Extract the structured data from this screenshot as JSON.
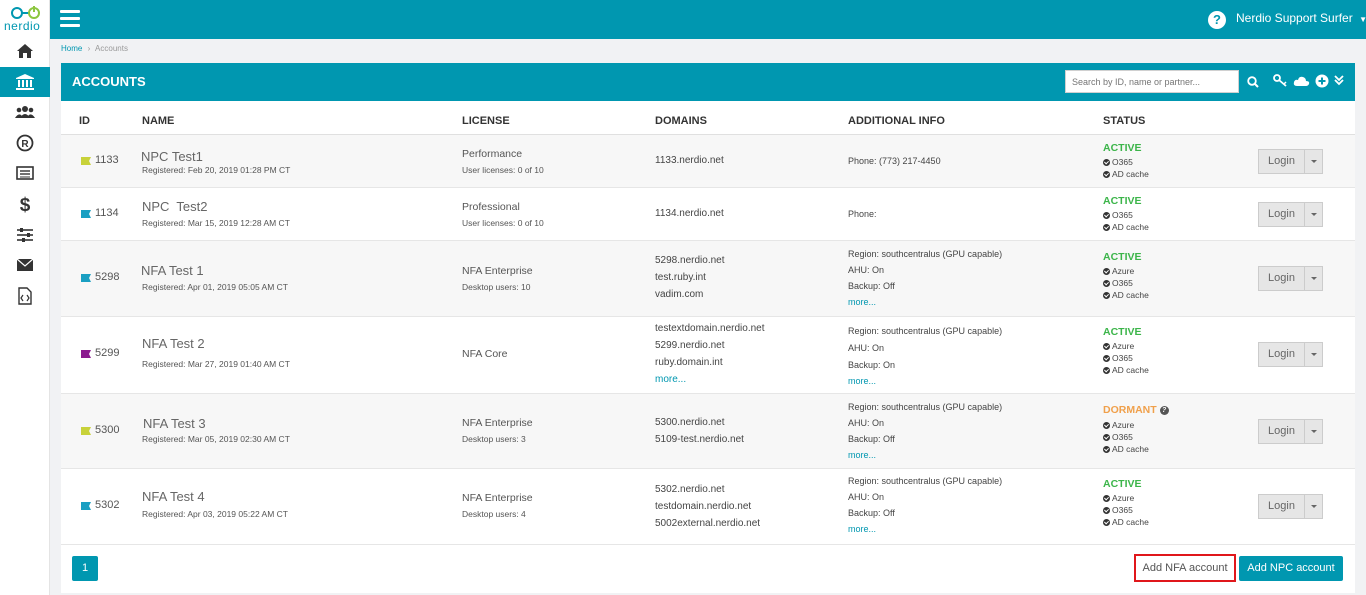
{
  "app": {
    "logo_text": "nerdio"
  },
  "topbar": {
    "user_name": "Nerdio Support Surfer"
  },
  "breadcrumb": {
    "home": "Home",
    "separator": "›",
    "current": "Accounts"
  },
  "panel": {
    "title": "ACCOUNTS",
    "search_placeholder": "Search by ID, name or partner..."
  },
  "columns": {
    "id": "ID",
    "name": "NAME",
    "license": "LICENSE",
    "domains": "DOMAINS",
    "info": "ADDITIONAL INFO",
    "status": "STATUS"
  },
  "colors": {
    "accent": "#0097b0",
    "active": "#3cb54a",
    "dormant": "#f0a04b",
    "highlight": "#e0171b"
  },
  "rows": [
    {
      "flag_color": "#c8d23a",
      "id": "1133",
      "name": "NPC Test1",
      "registered": "Registered: Feb 20, 2019 01:28 PM CT",
      "license": "Performance",
      "license_sub": "User licenses: 0 of 10",
      "domains": [
        "1133.nerdio.net"
      ],
      "info": [
        "Phone: (773) 217-4450"
      ],
      "info_more": "",
      "status": "ACTIVE",
      "services": [
        "O365",
        "AD cache"
      ],
      "login": "Login"
    },
    {
      "flag_color": "#1a9fc2",
      "id": "1134",
      "name": "NPC  Test2",
      "registered": "Registered: Mar 15, 2019 12:28 AM CT",
      "license": "Professional",
      "license_sub": "User licenses: 0 of 10",
      "domains": [
        "1134.nerdio.net"
      ],
      "info": [
        "Phone:"
      ],
      "info_more": "",
      "status": "ACTIVE",
      "services": [
        "O365",
        "AD cache"
      ],
      "login": "Login"
    },
    {
      "flag_color": "#1a9fc2",
      "id": "5298",
      "name": "NFA Test 1",
      "registered": "Registered: Apr 01, 2019 05:05 AM CT",
      "license": "NFA Enterprise",
      "license_sub": "Desktop users: 10",
      "domains": [
        "5298.nerdio.net",
        "test.ruby.int",
        "vadim.com"
      ],
      "info": [
        "Region: southcentralus (GPU capable)",
        "AHU: On",
        "Backup: Off"
      ],
      "info_more": "more...",
      "status": "ACTIVE",
      "services": [
        "Azure",
        "O365",
        "AD cache"
      ],
      "login": "Login"
    },
    {
      "flag_color": "#8b1a8f",
      "id": "5299",
      "name": "NFA Test 2",
      "registered": "Registered: Mar 27, 2019 01:40 AM CT",
      "license": "NFA Core",
      "license_sub": "",
      "domains": [
        "testextdomain.nerdio.net",
        "5299.nerdio.net",
        "ruby.domain.int"
      ],
      "domains_more": "more...",
      "info": [
        "Region: southcentralus (GPU capable)",
        "AHU: On",
        "Backup: On"
      ],
      "info_more": "more...",
      "status": "ACTIVE",
      "services": [
        "Azure",
        "O365",
        "AD cache"
      ],
      "login": "Login"
    },
    {
      "flag_color": "#c8d23a",
      "id": "5300",
      "name": "NFA Test 3",
      "registered": "Registered: Mar 05, 2019 02:30 AM CT",
      "license": "NFA Enterprise",
      "license_sub": "Desktop users: 3",
      "domains": [
        "5300.nerdio.net",
        "5109-test.nerdio.net"
      ],
      "info": [
        "Region: southcentralus (GPU capable)",
        "AHU: On",
        "Backup: Off"
      ],
      "info_more": "more...",
      "status": "DORMANT",
      "services": [
        "Azure",
        "O365",
        "AD cache"
      ],
      "login": "Login"
    },
    {
      "flag_color": "#1a9fc2",
      "id": "5302",
      "name": "NFA Test 4",
      "registered": "Registered: Apr 03, 2019 05:22 AM CT",
      "license": "NFA Enterprise",
      "license_sub": "Desktop users: 4",
      "domains": [
        "5302.nerdio.net",
        "testdomain.nerdio.net",
        "5002external.nerdio.net"
      ],
      "info": [
        "Region: southcentralus (GPU capable)",
        "AHU: On",
        "Backup: Off"
      ],
      "info_more": "more...",
      "status": "ACTIVE",
      "services": [
        "Azure",
        "O365",
        "AD cache"
      ],
      "login": "Login"
    }
  ],
  "footer": {
    "page": "1",
    "add_nfa": "Add NFA account",
    "add_npc": "Add NPC account"
  }
}
